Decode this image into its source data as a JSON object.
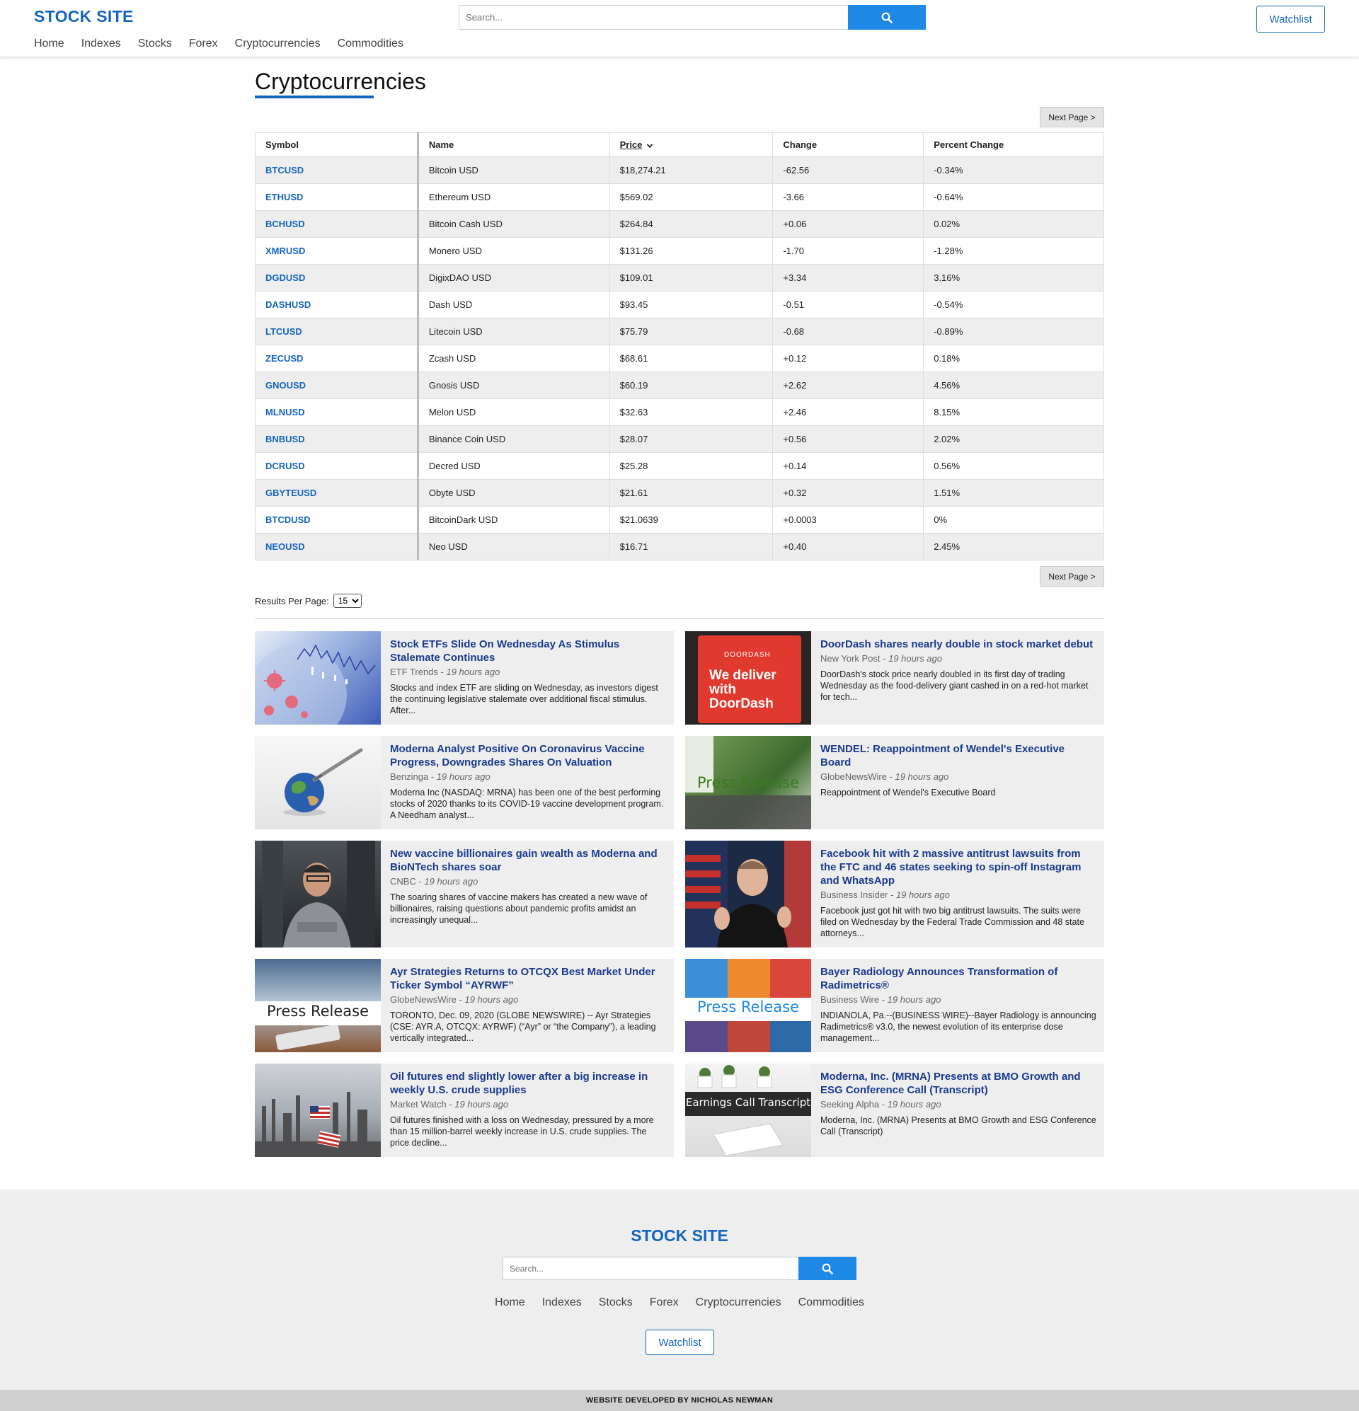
{
  "header": {
    "logo": "STOCK SITE",
    "nav": [
      "Home",
      "Indexes",
      "Stocks",
      "Forex",
      "Cryptocurrencies",
      "Commodities"
    ],
    "search_placeholder": "Search...",
    "watchlist_label": "Watchlist"
  },
  "main": {
    "title": "Cryptocurrencies",
    "next_page_label": "Next Page >",
    "results_per_page_label": "Results Per Page:",
    "results_per_page_value": "15",
    "table": {
      "headers": {
        "symbol": "Symbol",
        "name": "Name",
        "price": "Price",
        "change": "Change",
        "percent_change": "Percent Change"
      },
      "sort_column": "Price",
      "sort_direction": "descending",
      "rows": [
        {
          "symbol": "BTCUSD",
          "name": "Bitcoin USD",
          "price": "$18,274.21",
          "change": "-62.56",
          "pct": "-0.34%"
        },
        {
          "symbol": "ETHUSD",
          "name": "Ethereum USD",
          "price": "$569.02",
          "change": "-3.66",
          "pct": "-0.64%"
        },
        {
          "symbol": "BCHUSD",
          "name": "Bitcoin Cash USD",
          "price": "$264.84",
          "change": "+0.06",
          "pct": "0.02%"
        },
        {
          "symbol": "XMRUSD",
          "name": "Monero USD",
          "price": "$131.26",
          "change": "-1.70",
          "pct": "-1.28%"
        },
        {
          "symbol": "DGDUSD",
          "name": "DigixDAO USD",
          "price": "$109.01",
          "change": "+3.34",
          "pct": "3.16%"
        },
        {
          "symbol": "DASHUSD",
          "name": "Dash USD",
          "price": "$93.45",
          "change": "-0.51",
          "pct": "-0.54%"
        },
        {
          "symbol": "LTCUSD",
          "name": "Litecoin USD",
          "price": "$75.79",
          "change": "-0.68",
          "pct": "-0.89%"
        },
        {
          "symbol": "ZECUSD",
          "name": "Zcash USD",
          "price": "$68.61",
          "change": "+0.12",
          "pct": "0.18%"
        },
        {
          "symbol": "GNOUSD",
          "name": "Gnosis USD",
          "price": "$60.19",
          "change": "+2.62",
          "pct": "4.56%"
        },
        {
          "symbol": "MLNUSD",
          "name": "Melon USD",
          "price": "$32.63",
          "change": "+2.46",
          "pct": "8.15%"
        },
        {
          "symbol": "BNBUSD",
          "name": "Binance Coin USD",
          "price": "$28.07",
          "change": "+0.56",
          "pct": "2.02%"
        },
        {
          "symbol": "DCRUSD",
          "name": "Decred USD",
          "price": "$25.28",
          "change": "+0.14",
          "pct": "0.56%"
        },
        {
          "symbol": "GBYTEUSD",
          "name": "Obyte USD",
          "price": "$21.61",
          "change": "+0.32",
          "pct": "1.51%"
        },
        {
          "symbol": "BTCDUSD",
          "name": "BitcoinDark USD",
          "price": "$21.0639",
          "change": "+0.0003",
          "pct": "0%"
        },
        {
          "symbol": "NEOUSD",
          "name": "Neo USD",
          "price": "$16.71",
          "change": "+0.40",
          "pct": "2.45%"
        }
      ]
    }
  },
  "news": [
    {
      "image": "virus-chart-image",
      "title": "Stock ETFs Slide On Wednesday As Stimulus Stalemate Continues",
      "source": "ETF Trends",
      "ago": "19 hours ago",
      "snippet": "Stocks and index ETF are sliding on Wednesday, as investors digest the continuing legislative stalemate over additional fiscal stimulus. After..."
    },
    {
      "image": "doordash-image",
      "image_text": [
        "DOORDASH",
        "We deliver",
        "with",
        "DoorDash"
      ],
      "title": "DoorDash shares nearly double in stock market debut",
      "source": "New York Post",
      "ago": "19 hours ago",
      "snippet": "DoorDash's stock price nearly doubled in its first day of trading Wednesday as the food-delivery giant cashed in on a red-hot market for tech..."
    },
    {
      "image": "globe-syringe-image",
      "title": "Moderna Analyst Positive On Coronavirus Vaccine Progress, Downgrades Shares On Valuation",
      "source": "Benzinga",
      "ago": "19 hours ago",
      "snippet": "Moderna Inc (NASDAQ: MRNA) has been one of the best performing stocks of 2020 thanks to its COVID-19 vaccine development program. A Needham analyst..."
    },
    {
      "image": "press-release-image",
      "image_text": [
        "Press Release"
      ],
      "title": "WENDEL: Reappointment of Wendel's Executive Board",
      "source": "GlobeNewsWire",
      "ago": "19 hours ago",
      "snippet": "Reappointment of Wendel's Executive Board"
    },
    {
      "image": "portrait-image",
      "title": "New vaccine billionaires gain wealth as Moderna and BioNTech shares soar",
      "source": "CNBC",
      "ago": "19 hours ago",
      "snippet": "The soaring shares of vaccine makers has created a new wave of billionaires, raising questions about pandemic profits amidst an increasingly unequal..."
    },
    {
      "image": "speaker-flag-image",
      "title": "Facebook hit with 2 massive antitrust lawsuits from the FTC and 46 states seeking to spin-off Instagram and WhatsApp",
      "source": "Business Insider",
      "ago": "19 hours ago",
      "snippet": "Facebook just got hit with two big antitrust lawsuits. The suits were filed on Wednesday by the Federal Trade Commission and 48 state attorneys..."
    },
    {
      "image": "press-release-phone-image",
      "image_text": [
        "Press Release"
      ],
      "title": "Ayr Strategies Returns to OTCQX Best Market Under Ticker Symbol “AYRWF”",
      "source": "GlobeNewsWire",
      "ago": "19 hours ago",
      "snippet": "TORONTO, Dec. 09, 2020 (GLOBE NEWSWIRE) -- Ayr Strategies (CSE: AYR.A, OTCQX: AYRWF) (“Ayr” or “the Company”), a leading vertically integrated..."
    },
    {
      "image": "press-release-collage-image",
      "image_text": [
        "Press Release"
      ],
      "title": "Bayer Radiology Announces Transformation of Radimetrics®",
      "source": "Business Wire",
      "ago": "19 hours ago",
      "snippet": "INDIANOLA, Pa.--(BUSINESS WIRE)--Bayer Radiology is announcing Radimetrics® v3.0, the newest evolution of its enterprise dose management..."
    },
    {
      "image": "refinery-image",
      "title": "Oil futures end slightly lower after a big increase in weekly U.S. crude supplies",
      "source": "Market Watch",
      "ago": "19 hours ago",
      "snippet": "Oil futures finished with a loss on Wednesday, pressured by a more than 15 million-barrel weekly increase in U.S. crude supplies. The price decline..."
    },
    {
      "image": "earnings-call-image",
      "image_text": [
        "Earnings Call Transcript"
      ],
      "title": "Moderna, Inc. (MRNA) Presents at BMO Growth and ESG Conference Call (Transcript)",
      "source": "Seeking Alpha",
      "ago": "19 hours ago",
      "snippet": "Moderna, Inc. (MRNA) Presents at BMO Growth and ESG Conference Call (Transcript)"
    }
  ],
  "footer": {
    "logo": "STOCK SITE",
    "search_placeholder": "Search...",
    "nav": [
      "Home",
      "Indexes",
      "Stocks",
      "Forex",
      "Cryptocurrencies",
      "Commodities"
    ],
    "watchlist_label": "Watchlist",
    "credit": "WEBSITE DEVELOPED BY NICHOLAS NEWMAN"
  },
  "colors": {
    "brand": "#1565c0",
    "search_button": "#1e88e5",
    "negative": "#d32f2f",
    "positive": "#2e7d32",
    "news_title": "#1a3a8f"
  },
  "icons": [
    "search-icon",
    "chevron-down-icon"
  ]
}
